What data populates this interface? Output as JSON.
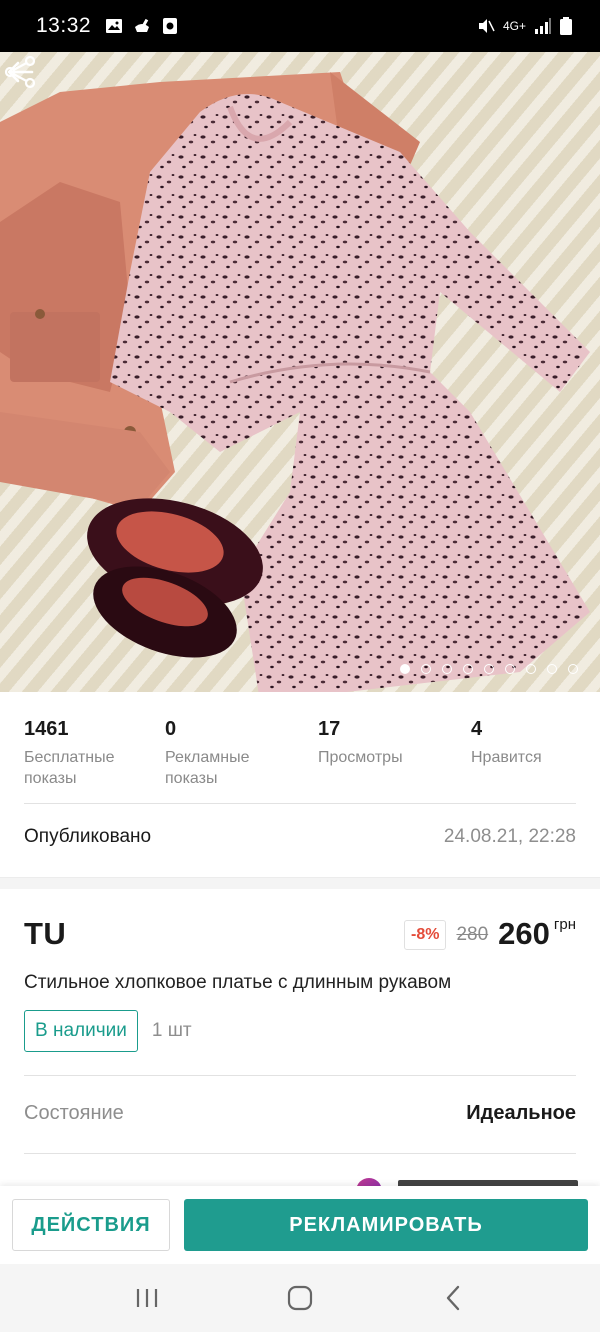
{
  "status_bar": {
    "time": "13:32",
    "network": "4G+"
  },
  "gallery": {
    "image_count": 9,
    "active_index": 0
  },
  "stats": [
    {
      "value": "1461",
      "label": "Бесплатные\nпоказы"
    },
    {
      "value": "0",
      "label": "Рекламные\nпоказы"
    },
    {
      "value": "17",
      "label": "Просмотры"
    },
    {
      "value": "4",
      "label": "Нравится"
    }
  ],
  "published": {
    "label": "Опубликовано",
    "date": "24.08.21, 22:28"
  },
  "product": {
    "brand": "TU",
    "discount": "-8%",
    "old_price": "280",
    "price": "260",
    "currency": "грн",
    "title": "Стильное хлопковое платье с длинным рукавом",
    "stock_label": "В наличии",
    "quantity": "1 шт"
  },
  "condition": {
    "label": "Состояние",
    "value": "Идеальное"
  },
  "actions": {
    "secondary": "ДЕЙСТВИЯ",
    "primary": "РЕКЛАМИРОВАТЬ"
  },
  "colors": {
    "accent": "#1f9c8f",
    "discount": "#e44c3a"
  }
}
